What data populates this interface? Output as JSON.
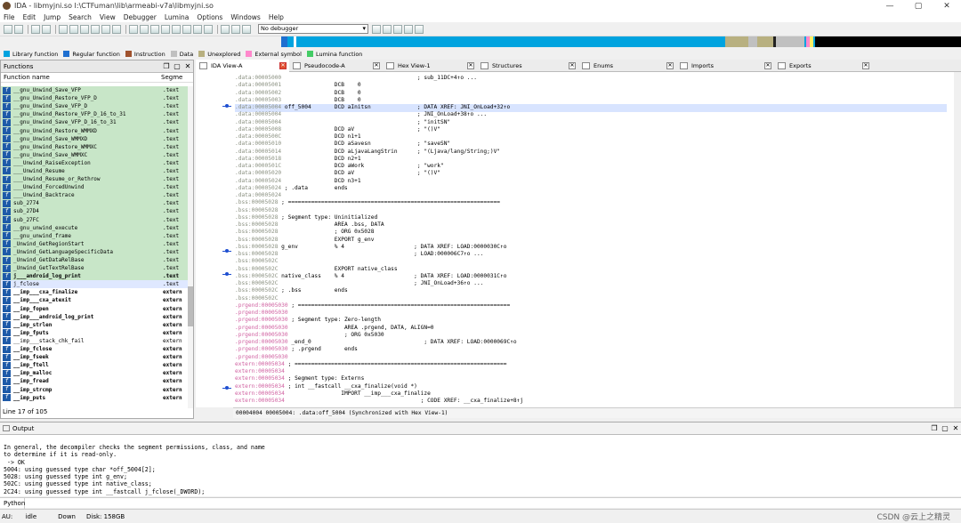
{
  "window": {
    "title": "IDA - libmyjni.so I:\\CTFuman\\lib\\armeabi-v7a\\libmyjni.so",
    "controls": [
      "—",
      "▢",
      "✕"
    ]
  },
  "menu": [
    "File",
    "Edit",
    "Jump",
    "Search",
    "View",
    "Debugger",
    "Lumina",
    "Options",
    "Windows",
    "Help"
  ],
  "toolbar": {
    "debugger_select": "No debugger"
  },
  "legend": [
    {
      "label": "Library function",
      "color": "#00a3df"
    },
    {
      "label": "Regular function",
      "color": "#1e6fd0"
    },
    {
      "label": "Instruction",
      "color": "#a0522d"
    },
    {
      "label": "Data",
      "color": "#c0c0c0"
    },
    {
      "label": "Unexplored",
      "color": "#b8b080"
    },
    {
      "label": "External symbol",
      "color": "#ff88cc"
    },
    {
      "label": "Lumina function",
      "color": "#44cc66"
    }
  ],
  "functions_panel": {
    "title": "Functions",
    "col_name": "Function name",
    "col_segment": "Segme",
    "line_info": "Line 17 of 105",
    "rows": [
      {
        "name": "__gnu_Unwind_Save_VFP",
        "seg": ".text",
        "kind": "lib"
      },
      {
        "name": "__gnu_Unwind_Restore_VFP_D",
        "seg": ".text",
        "kind": "lib"
      },
      {
        "name": "__gnu_Unwind_Save_VFP_D",
        "seg": ".text",
        "kind": "lib"
      },
      {
        "name": "__gnu_Unwind_Restore_VFP_D_16_to_31",
        "seg": ".text",
        "kind": "lib"
      },
      {
        "name": "__gnu_Unwind_Save_VFP_D_16_to_31",
        "seg": ".text",
        "kind": "lib"
      },
      {
        "name": "__gnu_Unwind_Restore_WMMXD",
        "seg": ".text",
        "kind": "lib"
      },
      {
        "name": "__gnu_Unwind_Save_WMMXD",
        "seg": ".text",
        "kind": "lib"
      },
      {
        "name": "__gnu_Unwind_Restore_WMMXC",
        "seg": ".text",
        "kind": "lib"
      },
      {
        "name": "__gnu_Unwind_Save_WMMXC",
        "seg": ".text",
        "kind": "lib"
      },
      {
        "name": "___Unwind_RaiseException",
        "seg": ".text",
        "kind": "lib"
      },
      {
        "name": "___Unwind_Resume",
        "seg": ".text",
        "kind": "lib"
      },
      {
        "name": "___Unwind_Resume_or_Rethrow",
        "seg": ".text",
        "kind": "lib"
      },
      {
        "name": "___Unwind_ForcedUnwind",
        "seg": ".text",
        "kind": "lib"
      },
      {
        "name": "___Unwind_Backtrace",
        "seg": ".text",
        "kind": "lib"
      },
      {
        "name": "sub_2774",
        "seg": ".text",
        "kind": "lib"
      },
      {
        "name": "sub_27D4",
        "seg": ".text",
        "kind": "lib"
      },
      {
        "name": "sub_27FC",
        "seg": ".text",
        "kind": "lib"
      },
      {
        "name": "__gnu_unwind_execute",
        "seg": ".text",
        "kind": "lib"
      },
      {
        "name": "__gnu_unwind_frame",
        "seg": ".text",
        "kind": "lib"
      },
      {
        "name": "_Unwind_GetRegionStart",
        "seg": ".text",
        "kind": "lib"
      },
      {
        "name": "_Unwind_GetLanguageSpecificData",
        "seg": ".text",
        "kind": "lib"
      },
      {
        "name": "_Unwind_GetDataRelBase",
        "seg": ".text",
        "kind": "lib"
      },
      {
        "name": "_Unwind_GetTextRelBase",
        "seg": ".text",
        "kind": "lib"
      },
      {
        "name": "j___android_log_print",
        "seg": ".text",
        "kind": "lib-bold"
      },
      {
        "name": "j_fclose",
        "seg": ".text",
        "kind": "sel"
      },
      {
        "name": "__imp___cxa_finalize",
        "seg": "extern",
        "kind": "bold"
      },
      {
        "name": "__imp___cxa_atexit",
        "seg": "extern",
        "kind": "bold"
      },
      {
        "name": "__imp_fopen",
        "seg": "extern",
        "kind": "bold"
      },
      {
        "name": "__imp___android_log_print",
        "seg": "extern",
        "kind": "bold"
      },
      {
        "name": "__imp_strlen",
        "seg": "extern",
        "kind": "bold"
      },
      {
        "name": "__imp_fputs",
        "seg": "extern",
        "kind": "bold"
      },
      {
        "name": "__imp___stack_chk_fail",
        "seg": "extern",
        "kind": "plain"
      },
      {
        "name": "__imp_fclose",
        "seg": "extern",
        "kind": "bold"
      },
      {
        "name": "__imp_fseek",
        "seg": "extern",
        "kind": "bold"
      },
      {
        "name": "__imp_ftell",
        "seg": "extern",
        "kind": "bold"
      },
      {
        "name": "__imp_malloc",
        "seg": "extern",
        "kind": "bold"
      },
      {
        "name": "__imp_fread",
        "seg": "extern",
        "kind": "bold"
      },
      {
        "name": "__imp_strcmp",
        "seg": "extern",
        "kind": "bold"
      },
      {
        "name": "__imp_puts",
        "seg": "extern",
        "kind": "bold"
      }
    ]
  },
  "tabs": [
    {
      "label": "IDA View-A",
      "active": true
    },
    {
      "label": "Pseudocode-A",
      "active": false
    },
    {
      "label": "Hex View-1",
      "active": false
    },
    {
      "label": "Structures",
      "active": false
    },
    {
      "label": "Enums",
      "active": false
    },
    {
      "label": "Imports",
      "active": false
    },
    {
      "label": "Exports",
      "active": false
    }
  ],
  "disasm_lines": [
    {
      "addr": ".data:00005000",
      "seg": "data",
      "body": "                                         ; sub_11DC+4↑o ..."
    },
    {
      "addr": ".data:00005001",
      "seg": "data",
      "body": "                DCB    0"
    },
    {
      "addr": ".data:00005002",
      "seg": "data",
      "body": "                DCB    0"
    },
    {
      "addr": ".data:00005003",
      "seg": "data",
      "body": "                DCB    0"
    },
    {
      "addr": ".data:00005004",
      "seg": "data",
      "body": " off_5004       DCD aInitsn              ; DATA XREF: JNI_OnLoad+32↑o",
      "hl": true
    },
    {
      "addr": ".data:00005004",
      "seg": "data",
      "body": "                                         ; JNI_OnLoad+38↑o ..."
    },
    {
      "addr": ".data:00005004",
      "seg": "data",
      "body": "                                         ; \"initSN\""
    },
    {
      "addr": ".data:00005008",
      "seg": "data",
      "body": "                DCD aV                   ; \"()V\""
    },
    {
      "addr": ".data:0000500C",
      "seg": "data",
      "body": "                DCD n1+1"
    },
    {
      "addr": ".data:00005010",
      "seg": "data",
      "body": "                DCD aSavesn              ; \"saveSN\""
    },
    {
      "addr": ".data:00005014",
      "seg": "data",
      "body": "                DCD aLjavaLangStrin      ; \"(Ljava/lang/String;)V\""
    },
    {
      "addr": ".data:00005018",
      "seg": "data",
      "body": "                DCD n2+1"
    },
    {
      "addr": ".data:0000501C",
      "seg": "data",
      "body": "                DCD aWork                ; \"work\""
    },
    {
      "addr": ".data:00005020",
      "seg": "data",
      "body": "                DCD aV                   ; \"()V\""
    },
    {
      "addr": ".data:00005024",
      "seg": "data",
      "body": "                DCD n3+1"
    },
    {
      "addr": ".data:00005024",
      "seg": "data",
      "body": " ; .data        ends"
    },
    {
      "addr": ".data:00005024",
      "seg": "data",
      "body": ""
    },
    {
      "addr": ".bss:00005028",
      "seg": "bss",
      "body": " ; ================================================================"
    },
    {
      "addr": ".bss:00005028",
      "seg": "bss",
      "body": ""
    },
    {
      "addr": ".bss:00005028",
      "seg": "bss",
      "body": " ; Segment type: Uninitialized"
    },
    {
      "addr": ".bss:00005028",
      "seg": "bss",
      "body": "                 AREA .bss, DATA"
    },
    {
      "addr": ".bss:00005028",
      "seg": "bss",
      "body": "                 ; ORG 0x5028"
    },
    {
      "addr": ".bss:00005028",
      "seg": "bss",
      "body": "                 EXPORT g_env"
    },
    {
      "addr": ".bss:00005028",
      "seg": "bss",
      "body": " g_env           % 4                     ; DATA XREF: LOAD:0000030C↑o"
    },
    {
      "addr": ".bss:00005028",
      "seg": "bss",
      "body": "                                         ; LOAD:000006C7↑o ..."
    },
    {
      "addr": ".bss:0000502C",
      "seg": "bss",
      "body": ""
    },
    {
      "addr": ".bss:0000502C",
      "seg": "bss",
      "body": "                 EXPORT native_class"
    },
    {
      "addr": ".bss:0000502C",
      "seg": "bss",
      "body": " native_class    % 4                     ; DATA XREF: LOAD:0000031C↑o"
    },
    {
      "addr": ".bss:0000502C",
      "seg": "bss",
      "body": "                                         ; JNI_OnLoad+36↑o ..."
    },
    {
      "addr": ".bss:0000502C",
      "seg": "bss",
      "body": " ; .bss          ends"
    },
    {
      "addr": ".bss:0000502C",
      "seg": "bss",
      "body": ""
    },
    {
      "addr": ".prgend:00005030",
      "seg": "prgend",
      "body": " ; ================================================================"
    },
    {
      "addr": ".prgend:00005030",
      "seg": "prgend",
      "body": ""
    },
    {
      "addr": ".prgend:00005030",
      "seg": "prgend",
      "body": " ; Segment type: Zero-length"
    },
    {
      "addr": ".prgend:00005030",
      "seg": "prgend",
      "body": "                 AREA .prgend, DATA, ALIGN=0"
    },
    {
      "addr": ".prgend:00005030",
      "seg": "prgend",
      "body": "                 ; ORG 0x5030"
    },
    {
      "addr": ".prgend:00005030",
      "seg": "prgend",
      "body": " _end_0                                  ; DATA XREF: LOAD:0000069C↑o"
    },
    {
      "addr": ".prgend:00005030",
      "seg": "prgend",
      "body": " ; .prgend       ends"
    },
    {
      "addr": ".prgend:00005030",
      "seg": "prgend",
      "body": ""
    },
    {
      "addr": "extern:00005034",
      "seg": "extern",
      "body": " ; ================================================================"
    },
    {
      "addr": "extern:00005034",
      "seg": "extern",
      "body": ""
    },
    {
      "addr": "extern:00005034",
      "seg": "extern",
      "body": " ; Segment type: Externs"
    },
    {
      "addr": "extern:00005034",
      "seg": "extern",
      "body": " ; int __fastcall __cxa_finalize(void *)"
    },
    {
      "addr": "extern:00005034",
      "seg": "extern",
      "body": "                 IMPORT __imp___cxa_finalize"
    },
    {
      "addr": "extern:00005034",
      "seg": "extern",
      "body": "                                         ; CODE XREF: __cxa_finalize+8↑j"
    }
  ],
  "disasm_status": "00004004 00005004: .data:off_5004 (Synchronized with Hex View-1)",
  "output_panel": {
    "title": "Output",
    "lines": [
      "In general, the decompiler checks the segment permissions, class, and name",
      "to determine if it is read-only.",
      " -> OK",
      "5004: using guessed type char *off_5004[2];",
      "5028: using guessed type int g_env;",
      "502C: using guessed type int native_class;",
      "2C24: using guessed type int __fastcall j_fclose(_DWORD);"
    ]
  },
  "python_label": "Python",
  "status": {
    "au": "AU:",
    "state": "idle",
    "dir": "Down",
    "disk": "Disk: 158GB"
  },
  "watermark": "CSDN @云上之精灵"
}
